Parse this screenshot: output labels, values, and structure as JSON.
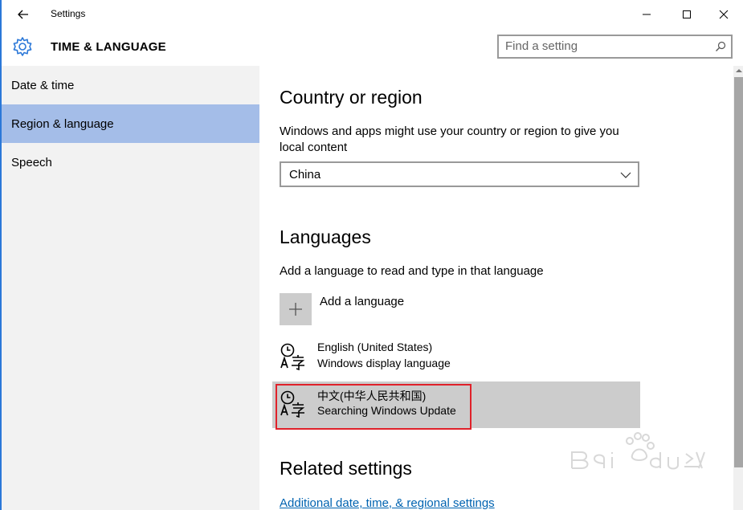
{
  "window": {
    "title": "Settings"
  },
  "header": {
    "title": "TIME & LANGUAGE",
    "search_placeholder": "Find a setting"
  },
  "sidebar": {
    "items": [
      {
        "label": "Date & time",
        "active": false
      },
      {
        "label": "Region & language",
        "active": true
      },
      {
        "label": "Speech",
        "active": false
      }
    ]
  },
  "country": {
    "heading": "Country or region",
    "description": "Windows and apps might use your country or region to give you local content",
    "selected": "China"
  },
  "languages": {
    "heading": "Languages",
    "description": "Add a language to read and type in that language",
    "add_label": "Add a language",
    "items": [
      {
        "name": "English (United States)",
        "status": "Windows display language"
      },
      {
        "name": "中文(中华人民共和国)",
        "status": "Searching Windows Update"
      }
    ]
  },
  "related": {
    "heading": "Related settings",
    "link": "Additional date, time, & regional settings"
  },
  "colors": {
    "accent": "#2b78d8",
    "selected_nav": "#a4bde8",
    "highlight": "#e0212a",
    "link": "#0063b1"
  }
}
